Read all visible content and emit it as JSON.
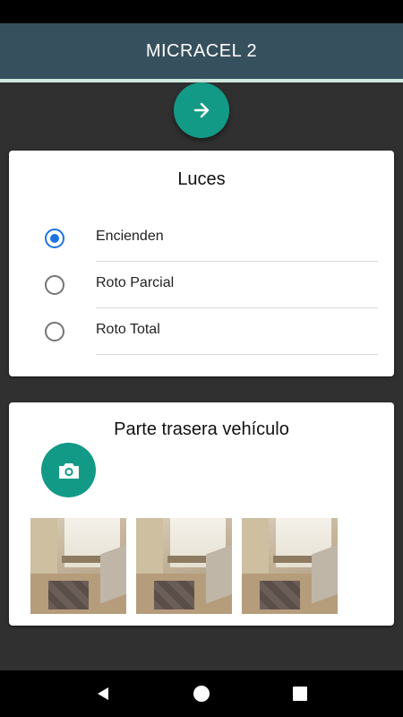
{
  "app": {
    "title": "MICRACEL 2"
  },
  "colors": {
    "appbar": "#37505e",
    "accent": "#129a86",
    "radio": "#1f73e0"
  },
  "next_button": {
    "icon": "arrow-right-icon"
  },
  "luces": {
    "title": "Luces",
    "options": [
      {
        "label": "Encienden",
        "selected": true
      },
      {
        "label": "Roto Parcial",
        "selected": false
      },
      {
        "label": "Roto Total",
        "selected": false
      }
    ]
  },
  "trasera": {
    "title": "Parte trasera vehículo",
    "camera_icon": "camera-icon",
    "photo_count": 3
  },
  "system_nav": {
    "icons": [
      "back-icon",
      "home-icon",
      "recents-icon"
    ]
  }
}
